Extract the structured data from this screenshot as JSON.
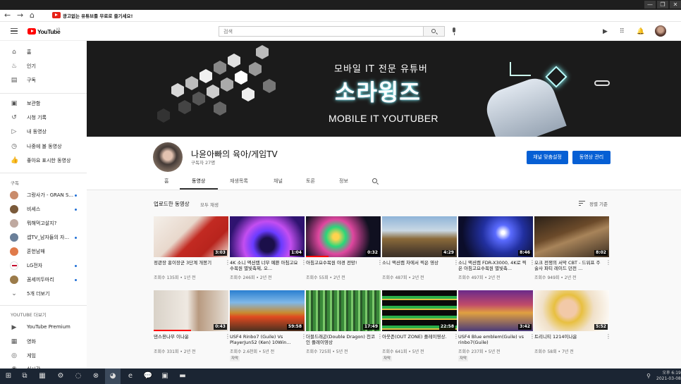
{
  "window": {
    "minimize": "—",
    "restore": "❐",
    "close": "✕"
  },
  "browser": {
    "back": "←",
    "forward": "→",
    "home": "⌂",
    "promo": "광고없는 유튜브를 무료로 즐기세요!"
  },
  "header": {
    "logo": "YouTube",
    "logo_region": "KR",
    "search_placeholder": "검색"
  },
  "sidebar": {
    "primary": [
      {
        "label": "홈",
        "icon": "home-icon",
        "glyph": "⌂"
      },
      {
        "label": "인기",
        "icon": "fire-icon",
        "glyph": "♨"
      },
      {
        "label": "구독",
        "icon": "subscriptions-icon",
        "glyph": "▤"
      }
    ],
    "library": [
      {
        "label": "보관함",
        "icon": "library-icon",
        "glyph": "▣"
      },
      {
        "label": "시청 기록",
        "icon": "history-icon",
        "glyph": "↺"
      },
      {
        "label": "내 동영상",
        "icon": "my-videos-icon",
        "glyph": "▷"
      },
      {
        "label": "나중에 볼 동영상",
        "icon": "watch-later-icon",
        "glyph": "◷"
      },
      {
        "label": "좋아요 표시한 동영상",
        "icon": "like-icon",
        "glyph": "👍"
      }
    ],
    "subs_heading": "구독",
    "subs": [
      {
        "label": "그랑사가 - GRAN S...",
        "color": "#c98b6b",
        "dot": true
      },
      {
        "label": "비세스",
        "color": "#7a5a3a",
        "dot": true
      },
      {
        "label": "뭐해먹고살지?",
        "color": "#bfa9a0",
        "dot": false
      },
      {
        "label": "셉TV_남자들의 자...",
        "color": "#6a7f99",
        "dot": true
      },
      {
        "label": "혼헌남매",
        "color": "#e07a4a",
        "dot": false
      },
      {
        "label": "LG전자",
        "color": "#c4002b",
        "dot": true
      },
      {
        "label": "꼼세끼두마리",
        "color": "#9b7b4a",
        "dot": true
      }
    ],
    "more": "5개 더보기",
    "more_heading": "YOUTUBE 더보기",
    "extras": [
      {
        "label": "YouTube Premium",
        "icon": "premium-icon",
        "glyph": "▶"
      },
      {
        "label": "영화",
        "icon": "movies-icon",
        "glyph": "▦"
      },
      {
        "label": "게임",
        "icon": "gaming-icon",
        "glyph": "◎"
      },
      {
        "label": "실시간",
        "icon": "live-icon",
        "glyph": "◉"
      }
    ]
  },
  "banner": {
    "subtitle": "모바일 IT 전문 유튜버",
    "title": "소라윙즈",
    "english": "MOBILE IT YOUTUBER"
  },
  "channel": {
    "name": "나윤아빠의 육아/게임TV",
    "subs": "구독자 27명",
    "customize_btn": "채널 맞춤설정",
    "manage_btn": "동영상 관리",
    "tabs": [
      "홈",
      "동영상",
      "재생목록",
      "채널",
      "토론",
      "정보"
    ]
  },
  "uploads": {
    "title": "업로드한 동영상",
    "play_all": "모두 재생",
    "sort": "정렬 기준"
  },
  "videos": [
    {
      "title": "정관장 홍이장군 3단계 개봉기",
      "views": "조회수 135회 • 1년 전",
      "duration": "3:03",
      "progress": 0,
      "cc": "",
      "thumb": "linear-gradient(135deg,#f4efe9 0%,#e8d8cc 40%,#c22a22 55%,#b8241d 75%,#f0e4da 100%)"
    },
    {
      "title": "4K 소니 액션캠 너무 예쁜 아침고요수목원 별빛축제, 오...",
      "views": "조회수 246회 • 2년 전",
      "duration": "1:04",
      "progress": 0,
      "cc": "",
      "thumb": "radial-gradient(circle at 50% 70%,#1b0f4a 0 15%,#6a3bff 30%,#c34ef0 50%,#2f1370 80%)"
    },
    {
      "title": "아침고요수목원 야경 전망!",
      "views": "조회수 55회 • 2년 전",
      "duration": "0:32",
      "progress": 0.3,
      "cc": "",
      "thumb": "radial-gradient(circle at 40% 50%,#ffd34e 0 6%,#2ad67a 20%,#e047a0 35%,#101020 70%)"
    },
    {
      "title": "소니 액션캠 차에서 찍은 영상",
      "views": "조회수 487회 • 2년 전",
      "duration": "4:29",
      "progress": 0,
      "cc": "",
      "thumb": "linear-gradient(180deg,#8fb4d8 0%,#c9d8e4 35%,#8a6a3a 55%,#5a4630 80%,#3a3026 100%)"
    },
    {
      "title": "소니 액션캠 FDR-X3000, 4K로 찍은 아침고요수목원 별빛축...",
      "views": "조회수 497회 • 2년 전",
      "duration": "8:46",
      "progress": 0,
      "cc": "",
      "thumb": "radial-gradient(circle at 60% 40%,#ffffff 0 3%,#5a6bff 15%,#2230a0 40%,#0b0d2a 80%)"
    },
    {
      "title": "오크 전쟁의 서막 CBT - 드워프 주술사 파티 레이드 던전 ...",
      "views": "조회수 949회 • 2년 전",
      "duration": "8:02",
      "progress": 0,
      "cc": "",
      "thumb": "linear-gradient(160deg,#2b2118 0%,#6b4a2a 40%,#a8845a 55%,#3a2c20 100%)"
    },
    {
      "title": "댄스용나무 이나윤",
      "views": "조회수 331회 • 2년 전",
      "duration": "0:43",
      "progress": 0.5,
      "cc": "",
      "thumb": "linear-gradient(90deg,#d9d2c8 0%,#efe9e2 45%,#b89a80 60%,#e6dfd6 100%)"
    },
    {
      "title": "USF4 Rinbo7 (Guile) Vs PlayerJun52 (Ken) 10Win...",
      "views": "조회수 2.6천회 • 5년 전",
      "duration": "59:58",
      "progress": 0,
      "cc": "자막",
      "thumb": "linear-gradient(180deg,#2a7fd0 0%,#7fb8e8 30%,#c88a30 55%,#e04a20 65%,#4a3020 100%)"
    },
    {
      "title": "더블드래곤(Double Dragon) 천코인 플레이영상",
      "views": "조회수 725회 • 5년 전",
      "duration": "17:49",
      "progress": 0,
      "cc": "",
      "thumb": "repeating-linear-gradient(90deg,#3a8a3a 0 4px,#7ac86a 4px 7px,#2a5a2a 7px 10px)"
    },
    {
      "title": "아웃존(OUT ZONE) 플레이영상.",
      "views": "조회수 641회 • 5년 전",
      "duration": "22:58",
      "progress": 0,
      "cc": "자막",
      "thumb": "repeating-linear-gradient(180deg,#0a0a0a 0 8px,#2ab04a 8px 12px,#e0c040 12px 14px)"
    },
    {
      "title": "USF4 Blue emblem(Guile) vs rinbo7(Guile)",
      "views": "조회수 237회 • 5년 전",
      "duration": "3:42",
      "progress": 0,
      "cc": "자막",
      "thumb": "linear-gradient(180deg,#6a2a8a 0%,#c04a6a 35%,#e0a040 55%,#4a3a7a 100%)"
    },
    {
      "title": "트리니티 1214이나윤",
      "views": "조회수 58회 • 7년 전",
      "duration": "5:52",
      "progress": 0,
      "cc": "",
      "thumb": "radial-gradient(circle at 45% 45%,#f2c9a8 0 18%,#e8c040 30%,#f0e0c8 55%,#ffffff 100%)"
    }
  ],
  "taskbar": {
    "icons": [
      {
        "name": "start-icon",
        "glyph": "⊞"
      },
      {
        "name": "task-view-icon",
        "glyph": "⧉"
      },
      {
        "name": "store-icon",
        "glyph": "▦"
      },
      {
        "name": "settings-icon",
        "glyph": "⚙"
      },
      {
        "name": "search-assistant-icon",
        "glyph": "◌"
      },
      {
        "name": "xbox-icon",
        "glyph": "⊗"
      },
      {
        "name": "chrome-icon",
        "glyph": "◕"
      },
      {
        "name": "edge-icon",
        "glyph": "e"
      },
      {
        "name": "kakaotalk-icon",
        "glyph": "💬"
      },
      {
        "name": "clip-icon",
        "glyph": "▣"
      },
      {
        "name": "file-explorer-icon",
        "glyph": "▬"
      }
    ],
    "time": "오후 6:19",
    "date": "2021-03-08"
  },
  "colors": {
    "youtube_red": "#ff0000",
    "button_blue": "#065fd4",
    "taskbar": "#1b2533"
  }
}
